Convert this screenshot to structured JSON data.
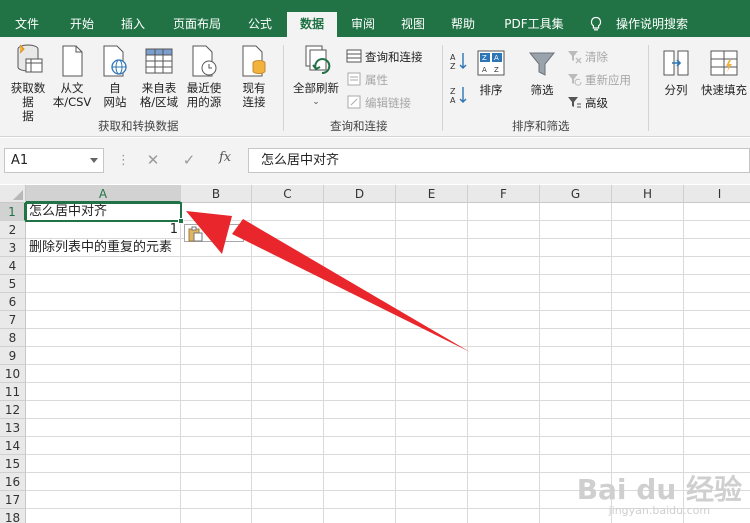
{
  "menu": {
    "tabs": [
      "文件",
      "开始",
      "插入",
      "页面布局",
      "公式",
      "数据",
      "审阅",
      "视图",
      "帮助",
      "PDF工具集"
    ],
    "active_tab": "数据",
    "help_search": "操作说明搜索"
  },
  "ribbon": {
    "get_transform": {
      "get_data": "获取数据",
      "get_data_line2": "据",
      "from_text_csv_1": "从文",
      "from_text_csv_2": "本/CSV",
      "from_web_1": "自",
      "from_web_2": "网站",
      "from_table_1": "来自表",
      "from_table_2": "格/区域",
      "recent_sources_1": "最近使",
      "recent_sources_2": "用的源",
      "existing_1": "现有",
      "existing_2": "连接",
      "group_label": "获取和转换数据"
    },
    "queries": {
      "refresh_all": "全部刷新",
      "queries_connections": "查询和连接",
      "properties": "属性",
      "edit_links": "编辑链接",
      "group_label": "查询和连接"
    },
    "sort_filter": {
      "sort": "排序",
      "filter": "筛选",
      "clear": "清除",
      "reapply": "重新应用",
      "advanced": "高级",
      "group_label": "排序和筛选"
    },
    "data_tools": {
      "split": "分列",
      "flash_fill": "快速填充"
    }
  },
  "formula_bar": {
    "name_box": "A1",
    "cancel": "✕",
    "enter": "✓",
    "fx": "fx",
    "content": "怎么居中对齐"
  },
  "sheet": {
    "columns": [
      "A",
      "B",
      "C",
      "D",
      "E",
      "F",
      "G",
      "H",
      "I"
    ],
    "rows": [
      "1",
      "2",
      "3",
      "4",
      "5",
      "6",
      "7",
      "8",
      "9",
      "10",
      "11",
      "12",
      "13",
      "14",
      "15",
      "16",
      "17",
      "18"
    ],
    "cells": {
      "A1": "怎么居中对齐",
      "A2": "1",
      "A3": "删除列表中的重复的元素"
    },
    "selected_cell": "A1"
  },
  "watermark": {
    "brand": "Bai du 经验",
    "url": "jingyan.baidu.com"
  },
  "colors": {
    "excel_green": "#217346",
    "arrow_red": "#e8262b"
  }
}
